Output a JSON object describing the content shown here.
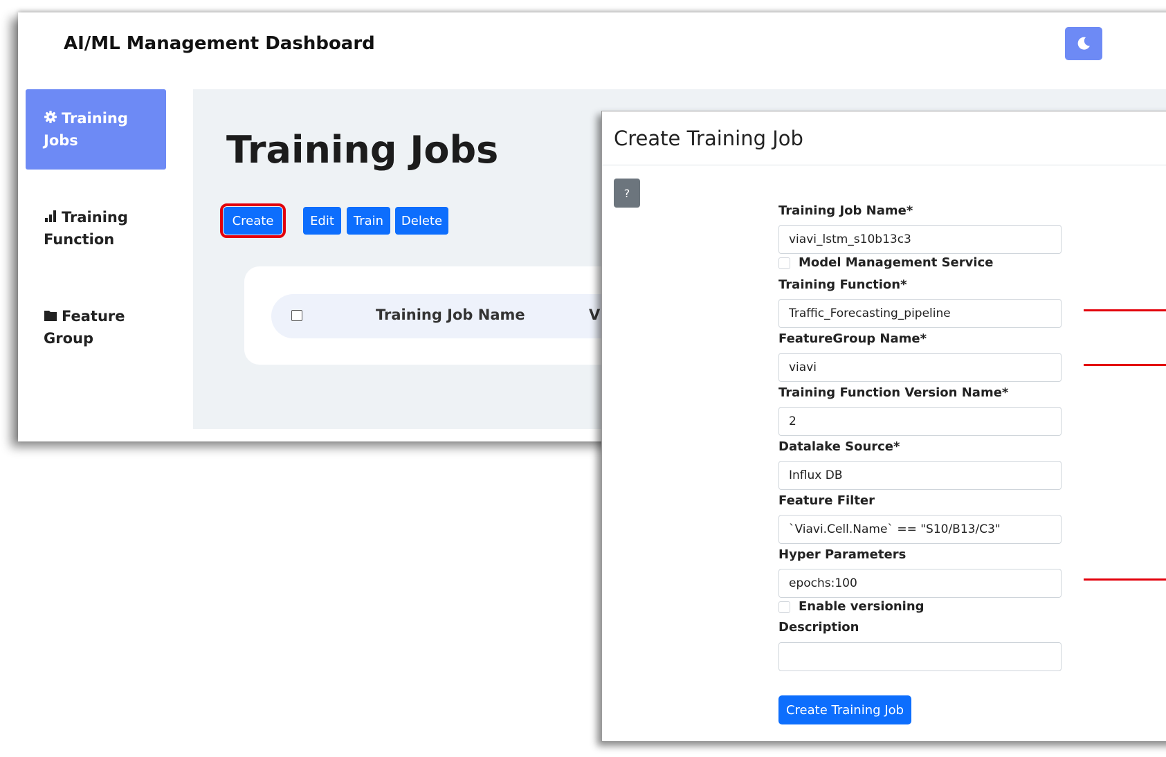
{
  "app": {
    "title": "AI/ML Management Dashboard",
    "theme_icon": "moon-icon"
  },
  "sidebar": {
    "items": [
      {
        "label": "Training Jobs",
        "icon": "gear-icon",
        "active": true
      },
      {
        "label": "Training Function",
        "icon": "bar-chart-icon",
        "active": false
      },
      {
        "label": "Feature Group",
        "icon": "folder-icon",
        "active": false
      }
    ]
  },
  "main": {
    "title": "Training Jobs",
    "toolbar": {
      "create": "Create",
      "edit": "Edit",
      "train": "Train",
      "delete": "Delete"
    },
    "table": {
      "columns": [
        "Training Job Name",
        "V"
      ]
    }
  },
  "modal": {
    "title": "Create Training Job",
    "help_label": "?",
    "fields": {
      "job_name": {
        "label": "Training Job Name*",
        "value": "viavi_lstm_s10b13c3"
      },
      "model_mgmt": {
        "label": "Model Management Service",
        "checked": false
      },
      "training_function": {
        "label": "Training Function*",
        "value": "Traffic_Forecasting_pipeline"
      },
      "feature_group": {
        "label": "FeatureGroup Name*",
        "value": "viavi"
      },
      "function_version": {
        "label": "Training Function Version Name*",
        "value": "2"
      },
      "datalake": {
        "label": "Datalake Source*",
        "value": "Influx DB"
      },
      "feature_filter": {
        "label": "Feature Filter",
        "value": "`Viavi.Cell.Name` == \"S10/B13/C3\""
      },
      "hyper_params": {
        "label": "Hyper Parameters",
        "value": "epochs:100"
      },
      "versioning": {
        "label": "Enable versioning",
        "checked": false
      },
      "description": {
        "label": "Description",
        "value": ""
      }
    },
    "submit": "Create Training Job"
  },
  "colors": {
    "primary": "#0d6efd",
    "sidebar_active": "#6d8af5",
    "highlight": "#e3000b",
    "help_button": "#6c757d"
  }
}
